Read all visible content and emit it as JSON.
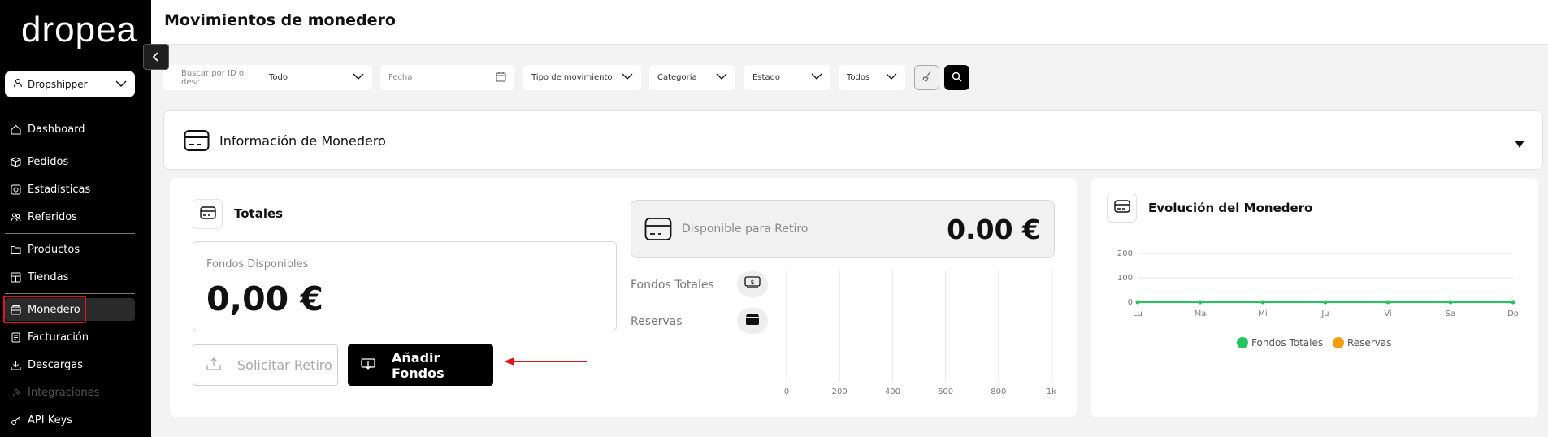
{
  "app": {
    "logo_text": "dropea",
    "role_select": "Dropshipper",
    "page_title": "Movimientos de monedero"
  },
  "sidebar": {
    "items": [
      {
        "label": "Dashboard",
        "icon": "home-icon"
      },
      {
        "label": "Pedidos",
        "icon": "box-icon"
      },
      {
        "label": "Estadísticas",
        "icon": "stats-icon"
      },
      {
        "label": "Referidos",
        "icon": "users-icon"
      },
      {
        "label": "Productos",
        "icon": "folder-icon"
      },
      {
        "label": "Tiendas",
        "icon": "store-icon"
      },
      {
        "label": "Monedero",
        "icon": "wallet-icon",
        "active": true
      },
      {
        "label": "Facturación",
        "icon": "invoice-icon"
      },
      {
        "label": "Descargas",
        "icon": "download-icon"
      },
      {
        "label": "Integraciones",
        "icon": "integrations-icon",
        "disabled": true
      },
      {
        "label": "API Keys",
        "icon": "key-icon"
      }
    ]
  },
  "filters": {
    "search_placeholder": "Buscar por ID o desc",
    "scope_value": "Todo",
    "date_placeholder": "Fecha",
    "movement_type": "Tipo de movimiento",
    "category": "Categoria",
    "status": "Estado",
    "all": "Todos"
  },
  "info": {
    "title": "Información de Monedero"
  },
  "totales": {
    "title": "Totales",
    "fondos_label": "Fondos Disponibles",
    "fondos_value": "0,00 €",
    "solicitar_label": "Solicitar Retiro",
    "anadir_label": "Añadir Fondos",
    "disponible_label": "Disponible para Retiro",
    "disponible_value": "0.00 €",
    "legend_totales": "Fondos Totales",
    "legend_reservas": "Reservas"
  },
  "evolucion": {
    "title": "Evolución del Monedero",
    "legend_totales": "Fondos Totales",
    "legend_reservas": "Reservas"
  },
  "colors": {
    "accent": "#000000",
    "highlight": "#e3141b",
    "series_totales": "#22c55e",
    "series_reservas": "#f59e0b"
  },
  "chart_data": [
    {
      "type": "bar",
      "orientation": "horizontal",
      "categories": [
        "Fondos Totales",
        "Reservas"
      ],
      "values": [
        0,
        0
      ],
      "xlim": [
        0,
        1000
      ],
      "x_ticks": [
        "0",
        "200",
        "400",
        "600",
        "800",
        "1k"
      ]
    },
    {
      "type": "line",
      "title": "Evolución del Monedero",
      "x": [
        "Lu",
        "Ma",
        "Mi",
        "Ju",
        "Vi",
        "Sa",
        "Do"
      ],
      "series": [
        {
          "name": "Fondos Totales",
          "values": [
            0,
            0,
            0,
            0,
            0,
            0,
            0
          ]
        },
        {
          "name": "Reservas",
          "values": [
            0,
            0,
            0,
            0,
            0,
            0,
            0
          ]
        }
      ],
      "ylim": [
        0,
        200
      ],
      "y_ticks": [
        "0",
        "100",
        "200"
      ],
      "legend": "bottom"
    }
  ]
}
